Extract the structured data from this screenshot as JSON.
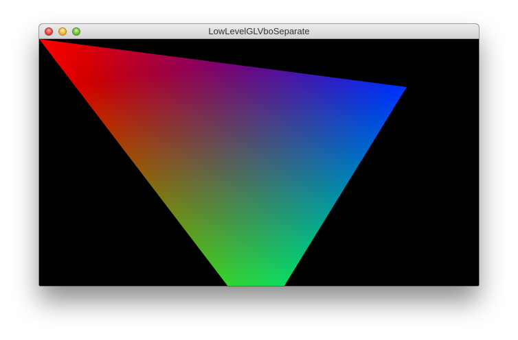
{
  "window": {
    "title": "LowLevelGLVboSeparate",
    "controls": {
      "close_icon": "close-icon",
      "minimize_icon": "minimize-icon",
      "zoom_icon": "zoom-icon"
    }
  },
  "scene": {
    "background_color": "#000000",
    "vertex_colors": [
      "#ff0000",
      "#0000ff",
      "#00ff00"
    ]
  }
}
